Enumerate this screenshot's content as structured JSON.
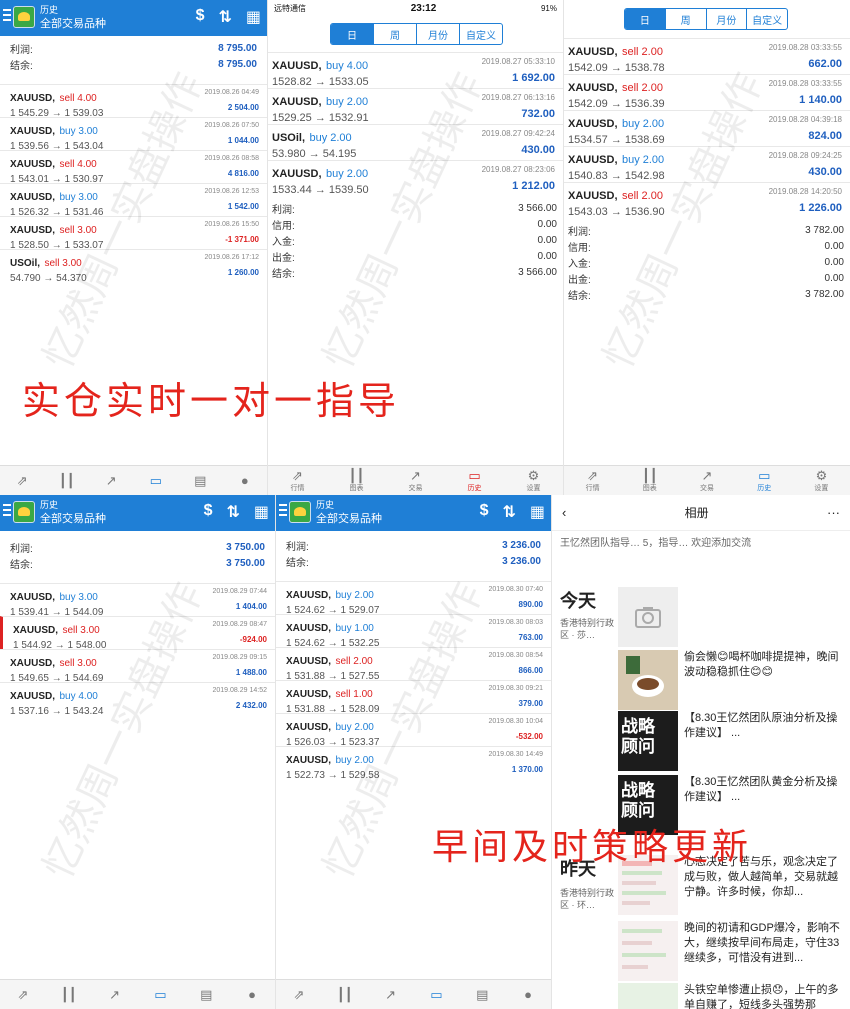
{
  "common": {
    "header_small": "历史",
    "header_big": "全部交易品种",
    "tabs": [
      "行情",
      "图表",
      "交易",
      "历史",
      "设置"
    ],
    "seg": [
      "日",
      "周",
      "月份",
      "自定义"
    ]
  },
  "panel1": {
    "summary": [
      {
        "label": "利润:",
        "value": "8 795.00"
      },
      {
        "label": "结余:",
        "value": "8 795.00"
      }
    ],
    "trades": [
      {
        "sym": "XAUUSD,",
        "side": "sell 4.00",
        "type": "sell",
        "px": "1 545.29 → 1 539.03",
        "dt": "2019.08.26 04:49",
        "pl": "2 504.00"
      },
      {
        "sym": "XAUUSD,",
        "side": "buy 3.00",
        "type": "buy",
        "px": "1 539.56 → 1 543.04",
        "dt": "2019.08.26 07:50",
        "pl": "1 044.00"
      },
      {
        "sym": "XAUUSD,",
        "side": "sell 4.00",
        "type": "sell",
        "px": "1 543.01 → 1 530.97",
        "dt": "2019.08.26 08:58",
        "pl": "4 816.00"
      },
      {
        "sym": "XAUUSD,",
        "side": "buy 3.00",
        "type": "buy",
        "px": "1 526.32 → 1 531.46",
        "dt": "2019.08.26 12:53",
        "pl": "1 542.00"
      },
      {
        "sym": "XAUUSD,",
        "side": "sell 3.00",
        "type": "sell",
        "px": "1 528.50 → 1 533.07",
        "dt": "2019.08.26 15:50",
        "pl": "-1 371.00"
      },
      {
        "sym": "USOil,",
        "side": "sell 3.00",
        "type": "sell",
        "px": "54.790 → 54.370",
        "dt": "2019.08.26 17:12",
        "pl": "1 260.00"
      }
    ]
  },
  "panel2": {
    "carrier": "远特通信",
    "time": "23:12",
    "battery": "91%",
    "trades": [
      {
        "sym": "XAUUSD,",
        "side": "buy 4.00",
        "type": "buy",
        "px": "1528.82 → 1533.05",
        "dt": "2019.08.27 05:33:10",
        "pl": "1 692.00"
      },
      {
        "sym": "XAUUSD,",
        "side": "buy 2.00",
        "type": "buy",
        "px": "1529.25 → 1532.91",
        "dt": "2019.08.27 06:13:16",
        "pl": "732.00"
      },
      {
        "sym": "USOil,",
        "side": "buy 2.00",
        "type": "buy",
        "px": "53.980 → 54.195",
        "dt": "2019.08.27 09:42:24",
        "pl": "430.00"
      },
      {
        "sym": "XAUUSD,",
        "side": "buy 2.00",
        "type": "buy",
        "px": "1533.44 → 1539.50",
        "dt": "2019.08.27 08:23:06",
        "pl": "1 212.00"
      }
    ],
    "summary": [
      {
        "label": "利润:",
        "value": "3 566.00"
      },
      {
        "label": "信用:",
        "value": "0.00"
      },
      {
        "label": "入金:",
        "value": "0.00"
      },
      {
        "label": "出金:",
        "value": "0.00"
      },
      {
        "label": "结余:",
        "value": "3 566.00"
      }
    ]
  },
  "panel3": {
    "trades": [
      {
        "sym": "XAUUSD,",
        "side": "sell 2.00",
        "type": "sell",
        "px": "1542.09 → 1538.78",
        "dt": "2019.08.28 03:33:55",
        "pl": "662.00"
      },
      {
        "sym": "XAUUSD,",
        "side": "sell 2.00",
        "type": "sell",
        "px": "1542.09 → 1536.39",
        "dt": "2019.08.28 03:33:55",
        "pl": "1 140.00"
      },
      {
        "sym": "XAUUSD,",
        "side": "buy 2.00",
        "type": "buy",
        "px": "1534.57 → 1538.69",
        "dt": "2019.08.28 04:39:18",
        "pl": "824.00"
      },
      {
        "sym": "XAUUSD,",
        "side": "buy 2.00",
        "type": "buy",
        "px": "1540.83 → 1542.98",
        "dt": "2019.08.28 09:24:25",
        "pl": "430.00"
      },
      {
        "sym": "XAUUSD,",
        "side": "sell 2.00",
        "type": "sell",
        "px": "1543.03 → 1536.90",
        "dt": "2019.08.28 14:20:50",
        "pl": "1 226.00"
      }
    ],
    "summary": [
      {
        "label": "利润:",
        "value": "3 782.00"
      },
      {
        "label": "信用:",
        "value": "0.00"
      },
      {
        "label": "入金:",
        "value": "0.00"
      },
      {
        "label": "出金:",
        "value": "0.00"
      },
      {
        "label": "结余:",
        "value": "3 782.00"
      }
    ]
  },
  "panel4": {
    "summary": [
      {
        "label": "利润:",
        "value": "3 750.00"
      },
      {
        "label": "结余:",
        "value": "3 750.00"
      }
    ],
    "trades": [
      {
        "sym": "XAUUSD,",
        "side": "buy 3.00",
        "type": "buy",
        "px": "1 539.41 → 1 544.09",
        "dt": "2019.08.29 07:44",
        "pl": "1 404.00"
      },
      {
        "sym": "XAUUSD,",
        "side": "sell 3.00",
        "type": "sell",
        "px": "1 544.92 → 1 548.00",
        "dt": "2019.08.29 08:47",
        "pl": "-924.00"
      },
      {
        "sym": "XAUUSD,",
        "side": "sell 3.00",
        "type": "sell",
        "px": "1 549.65 → 1 544.69",
        "dt": "2019.08.29 09:15",
        "pl": "1 488.00"
      },
      {
        "sym": "XAUUSD,",
        "side": "buy 4.00",
        "type": "buy",
        "px": "1 537.16 → 1 543.24",
        "dt": "2019.08.29 14:52",
        "pl": "2 432.00"
      }
    ]
  },
  "panel5": {
    "summary": [
      {
        "label": "利润:",
        "value": "3 236.00"
      },
      {
        "label": "结余:",
        "value": "3 236.00"
      }
    ],
    "trades": [
      {
        "sym": "XAUUSD,",
        "side": "buy 2.00",
        "type": "buy",
        "px": "1 524.62 → 1 529.07",
        "dt": "2019.08.30 07:40",
        "pl": "890.00"
      },
      {
        "sym": "XAUUSD,",
        "side": "buy 1.00",
        "type": "buy",
        "px": "1 524.62 → 1 532.25",
        "dt": "2019.08.30 08:03",
        "pl": "763.00"
      },
      {
        "sym": "XAUUSD,",
        "side": "sell 2.00",
        "type": "sell",
        "px": "1 531.88 → 1 527.55",
        "dt": "2019.08.30 08:54",
        "pl": "866.00"
      },
      {
        "sym": "XAUUSD,",
        "side": "sell 1.00",
        "type": "sell",
        "px": "1 531.88 → 1 528.09",
        "dt": "2019.08.30 09:21",
        "pl": "379.00"
      },
      {
        "sym": "XAUUSD,",
        "side": "buy 2.00",
        "type": "buy",
        "px": "1 526.03 → 1 523.37",
        "dt": "2019.08.30 10:04",
        "pl": "-532.00"
      },
      {
        "sym": "XAUUSD,",
        "side": "buy 2.00",
        "type": "buy",
        "px": "1 522.73 → 1 529.58",
        "dt": "2019.08.30 14:49",
        "pl": "1 370.00"
      }
    ]
  },
  "album": {
    "title": "相册",
    "more": "···",
    "desc": "王忆然团队指导…        5，指导… 欢迎添加交流",
    "today": "今天",
    "yesterday": "昨天",
    "location": "香港特别行政区 · 莎…",
    "location2": "香港特别行政区 · 环…",
    "posts": [
      "偷会懒😊喝杯咖啡提提神，晚间波动稳稳抓住😊😊",
      "【8.30王忆然团队原油分析及操作建议】 ...",
      "【8.30王忆然团队黄金分析及操作建议】 ...",
      "心态决定了苦与乐，观念决定了成与败，做人越简单，交易就越宁静。许多时候，你却...",
      "晚间的初请和GDP爆冷，影响不大，继续按早间布局走，守住33继续多，可惜没有进到...",
      "头铁空单惨遭止损😞，上午的多单自赚了，短线多头强势那"
    ],
    "thumb_text": "战略顾问"
  },
  "overlay": {
    "line1": "实仓实时一对一指导",
    "line2": "早间及时策略更新",
    "watermark": "忆然周一实盘操作"
  }
}
